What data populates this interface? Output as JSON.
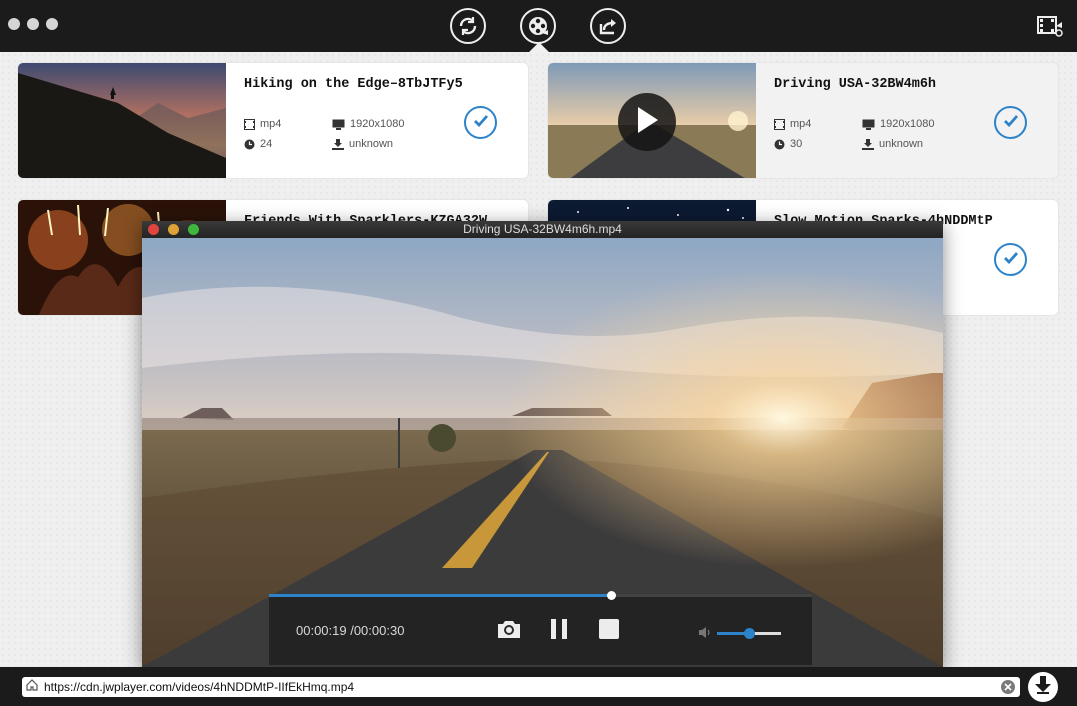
{
  "app": {
    "toolbar": {
      "icons": [
        "convert-icon",
        "video-reel-icon",
        "share-icon",
        "video-list-icon"
      ]
    }
  },
  "cards": [
    {
      "title": "Hiking on the Edge–8TbJTFy5",
      "format": "mp4",
      "resolution": "1920x1080",
      "duration": "24",
      "size": "unknown",
      "checked": true
    },
    {
      "title": "Driving USA-32BW4m6h",
      "format": "mp4",
      "resolution": "1920x1080",
      "duration": "30",
      "size": "unknown",
      "checked": true,
      "selected": true
    },
    {
      "title": "Friends With Sparklers-KZGA32W",
      "checked": false
    },
    {
      "title": "Slow Motion Sparks-4hNDDMtP",
      "checked": true
    }
  ],
  "player": {
    "title": "Driving USA-32BW4m6h.mp4",
    "time_label": "00:00:19 /00:00:30",
    "progress": 0.63,
    "volume": 0.5
  },
  "url_bar": {
    "value": "https://cdn.jwplayer.com/videos/4hNDDMtP-IIfEkHmq.mp4"
  },
  "colors": {
    "accent": "#2d83c9",
    "bar": "#1b1b1b"
  }
}
